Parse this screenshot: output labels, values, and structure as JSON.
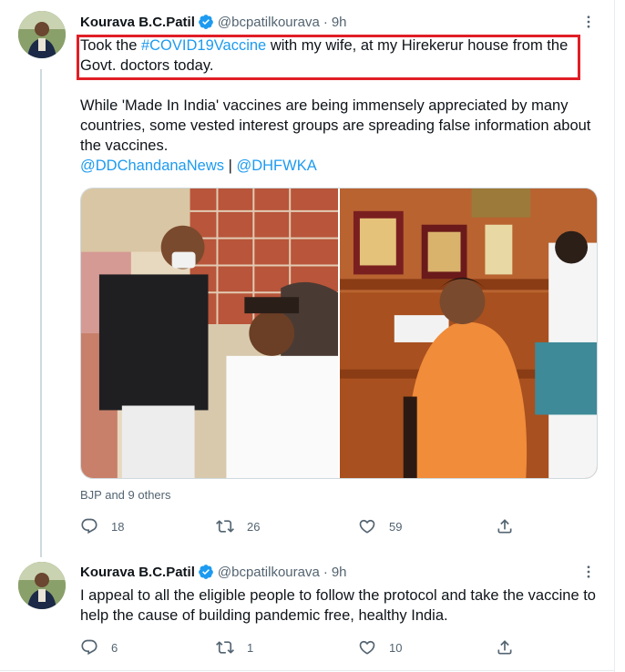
{
  "tweets": [
    {
      "author": {
        "name": "Kourava B.C.Patil",
        "handle": "@bcpatilkourava",
        "verified": true
      },
      "time": "9h",
      "text": {
        "line1_pre": "Took the ",
        "hashtag": "#COVID19Vaccine",
        "line1_post": " with my wife, at my Hirekerur house from the Govt. doctors today.",
        "paragraph2": "While 'Made In India' vaccines are being immensely appreciated by many countries, some vested interest groups are spreading false information about the vaccines.",
        "mention1": "@DDChandanaNews",
        "separator": " | ",
        "mention2": "@DHFWKA"
      },
      "liked_by": "BJP and 9 others",
      "stats": {
        "replies": "18",
        "retweets": "26",
        "likes": "59"
      }
    },
    {
      "author": {
        "name": "Kourava B.C.Patil",
        "handle": "@bcpatilkourava",
        "verified": true
      },
      "time": "9h",
      "text": "I appeal to all the eligible people to follow the protocol and take the vaccine to help the cause of building pandemic free, healthy India.",
      "stats": {
        "replies": "6",
        "retweets": "1",
        "likes": "10"
      }
    }
  ],
  "ui": {
    "separator_dot": "·",
    "accent": "#1d9bf0",
    "highlight_color": "#e01e26",
    "icons": [
      "verified-badge-icon",
      "more-options-icon",
      "reply-icon",
      "retweet-icon",
      "like-icon",
      "share-icon"
    ]
  }
}
